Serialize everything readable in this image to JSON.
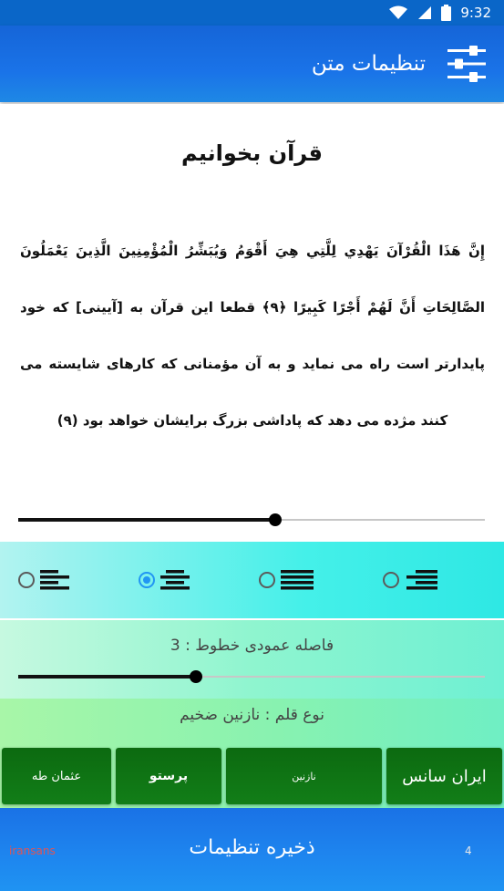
{
  "status_bar": {
    "time": "9:32",
    "icons": [
      "wifi-icon",
      "signal-icon",
      "battery-icon"
    ]
  },
  "app_bar": {
    "title": "تنظیمات متن",
    "icon": "settings-sliders-icon"
  },
  "preview": {
    "heading": "قرآن بخوانیم",
    "body": "إِنَّ هَذَا الْقُرْآنَ يَهْدِي لِلَّتِي هِيَ أَقْوَمُ وَيُبَشِّرُ الْمُؤْمِنِينَ الَّذِينَ يَعْمَلُونَ الصَّالِحَاتِ أَنَّ لَهُمْ أَجْرًا كَبِيرًا ﴿٩﴾ قطعا این قرآن به [آیینی] که خود پایدارتر است راه می نماید و به آن مؤمنانی که کارهای شایسته می کنند مژده می دهد که پاداشی بزرگ برایشان خواهد بود (۹)"
  },
  "text_size_slider": {
    "value_fraction": 0.55
  },
  "alignment": {
    "options": [
      {
        "name": "align-left",
        "icon": "align-left-icon",
        "selected": false
      },
      {
        "name": "align-center",
        "icon": "align-center-icon",
        "selected": true
      },
      {
        "name": "align-justify",
        "icon": "align-justify-icon",
        "selected": false
      },
      {
        "name": "align-right",
        "icon": "align-right-icon",
        "selected": false
      }
    ]
  },
  "line_spacing": {
    "label": "فاصله عمودی خطوط  :  3",
    "value_fraction": 0.38
  },
  "font": {
    "label": "نوع قلم : نازنین ضخیم",
    "buttons": [
      "ایران سانس",
      "نازنین",
      "پرستو",
      "عثمان طه"
    ]
  },
  "save_bar": {
    "label": "ذخیره تنظیمات",
    "font_name": "iransans",
    "font_size": "4"
  },
  "colors": {
    "app_bar": "#1a73e8",
    "align_panel": "#45f0e9",
    "spacing_panel": "#8ff5cf",
    "font_panel": "#88f2b0",
    "font_button": "#0c6a10",
    "radio_selected": "#2196f3"
  }
}
